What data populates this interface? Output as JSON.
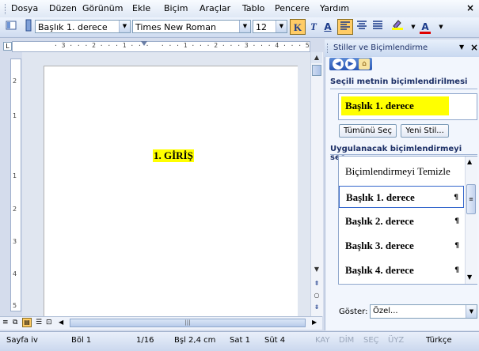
{
  "menu": {
    "items": [
      "Dosya",
      "Düzen",
      "Görünüm",
      "Ekle",
      "Biçim",
      "Araçlar",
      "Tablo",
      "Pencere",
      "Yardım"
    ],
    "close_glyph": "×"
  },
  "toolbar": {
    "style_combo": "Başlık 1. derece",
    "font_combo": "Times New Roman",
    "size_combo": "12",
    "bold_label": "K",
    "italic_label": "T",
    "underline_label": "A",
    "font_color_label": "A"
  },
  "ruler": {
    "horizontal_marks": "· 3 · · · 2 · · · 1 · · ·   · · · 1 · · · 2 · · · 3 · · · 4 · · · 5",
    "vertical_marks": [
      "2",
      "1",
      "1",
      "2",
      "3",
      "4",
      "5"
    ]
  },
  "document": {
    "heading_text": "1. GİRİŞ",
    "highlight_color": "#ffff00"
  },
  "statusbar": {
    "page": "Sayfa iv",
    "section": "Böl 1",
    "page_of": "1/16",
    "position": "Bşl 2,4 cm",
    "line": "Sat 1",
    "column": "Süt 4",
    "kay": "KAY",
    "dim": "DİM",
    "sec": "SEÇ",
    "uyz": "ÜYZ",
    "language": "Türkçe"
  },
  "task_pane": {
    "title": "Stiller ve Biçimlendirme",
    "selected_label": "Seçili metnin biçimlendirilmesi",
    "selected_style": "Başlık 1. derece",
    "select_all_button": "Tümünü Seç",
    "new_style_button": "Yeni Stil...",
    "apply_label": "Uygulanacak biçimlendirmeyi seç",
    "styles": [
      {
        "name": "Biçimlendirmeyi Temizle",
        "bold": false,
        "mark": ""
      },
      {
        "name": "Başlık 1. derece",
        "bold": true,
        "mark": "¶"
      },
      {
        "name": "Başlık 2. derece",
        "bold": true,
        "mark": "¶"
      },
      {
        "name": "Başlık 3. derece",
        "bold": true,
        "mark": "¶"
      },
      {
        "name": "Başlık 4. derece",
        "bold": true,
        "mark": "¶"
      }
    ],
    "show_label": "Göster:",
    "show_value": "Özel..."
  },
  "colors": {
    "accent": "#2a57b4",
    "highlight": "#ffff00"
  }
}
